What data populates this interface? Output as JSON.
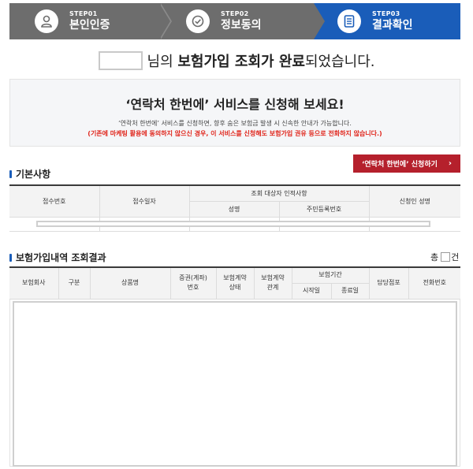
{
  "steps": [
    {
      "no": "STEP01",
      "name": "본인인증",
      "icon": "person-icon",
      "active": false
    },
    {
      "no": "STEP02",
      "name": "정보동의",
      "icon": "check-circle-icon",
      "active": false
    },
    {
      "no": "STEP03",
      "name": "결과확인",
      "icon": "document-icon",
      "active": true
    }
  ],
  "colors": {
    "active_step": "#1a5db9",
    "inactive_step": "#6d6d6d",
    "accent_red": "#b5202c",
    "warn_text": "#e0251b"
  },
  "result": {
    "name_value": "",
    "suffix1": "님의",
    "bold": "보험가입 조회가 완료",
    "suffix2": "되었습니다."
  },
  "banner": {
    "title": "‘연락처 한번에’ 서비스를 신청해 보세요!",
    "desc": "‘연락처 한번에’ 서비스를 신청하면, 향후 숨은 보험금 발생 시 신속한 안내가 가능합니다.",
    "warning": "(기존에 마케팅 활용에 동의하지 않으신 경우, 이 서비스를 신청해도 보험가입 권유 등으로 전화하지 않습니다.)"
  },
  "basic_section": {
    "title": "기본사항",
    "apply_button": "‘연락처 한번에’ 신청하기",
    "apply_chevron": "›",
    "headers": {
      "receipt_no": "접수번호",
      "receipt_date": "접수일자",
      "subject_info": "조회 대상자 인적사항",
      "name": "성명",
      "rrn": "주민등록번호",
      "applicant": "신청인 성명"
    }
  },
  "insurance_section": {
    "title": "보험가입내역 조회결과",
    "total_label": "총",
    "total_count": "",
    "total_unit": "건",
    "headers": {
      "company": "보험회사",
      "category": "구분",
      "product": "상품명",
      "policy_no_1": "증권(계좌)",
      "policy_no_2": "번호",
      "contract_status_1": "보험계약",
      "contract_status_2": "상태",
      "contract_relation_1": "보험계약",
      "contract_relation_2": "관계",
      "period": "보험기간",
      "start": "시작일",
      "end": "종료일",
      "branch": "담당점포",
      "phone": "전화번호"
    }
  }
}
